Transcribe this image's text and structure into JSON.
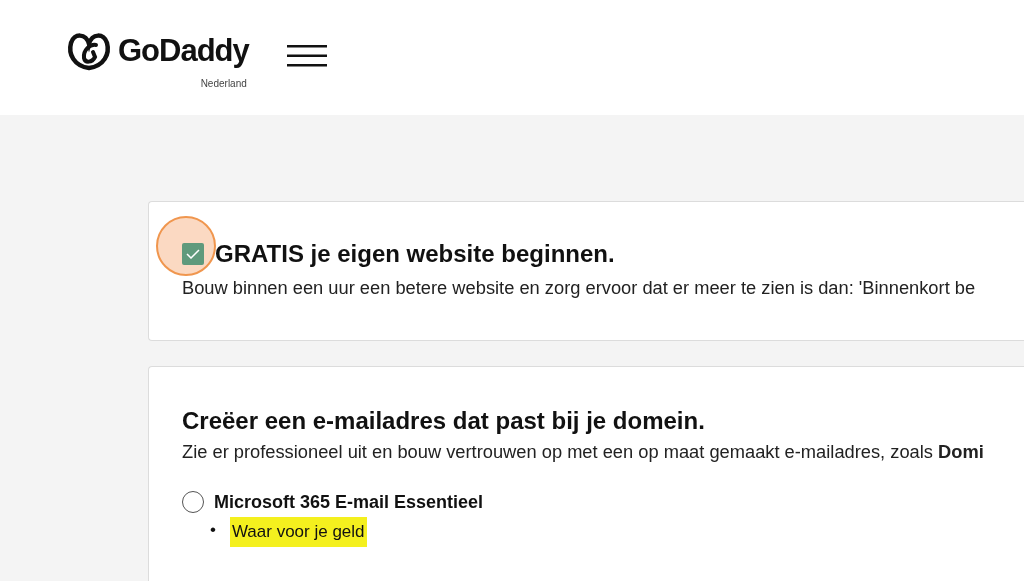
{
  "header": {
    "logo": {
      "text": "GoDaddy",
      "region": "Nederland"
    }
  },
  "cards": [
    {
      "kind": "checkbox",
      "checked": true,
      "highlighted": true,
      "title": "GRATIS je eigen website beginnen.",
      "description": "Bouw binnen een uur een betere website en zorg ervoor dat er meer te zien is dan: 'Binnenkort be"
    },
    {
      "kind": "options",
      "title": "Creëer een e-mailadres dat past bij je domein.",
      "description": "Zie er professioneel uit en bouw vertrouwen op met een op maat gemaakt e-mailadres, zoals **Domi**",
      "options": [
        {
          "label": "Microsoft 365 E-mail Essentieel",
          "selected": false,
          "features": [
            {
              "marker": "•",
              "text": "Waar voor je geld",
              "highlighted": true
            }
          ]
        }
      ]
    }
  ]
}
